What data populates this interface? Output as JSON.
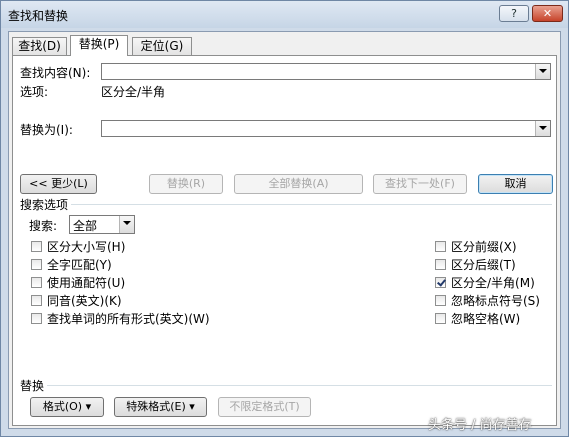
{
  "window": {
    "title": "查找和替换",
    "help_label": "?",
    "close_label": "✕"
  },
  "tabs": [
    {
      "label": "查找(D)",
      "selected": false
    },
    {
      "label": "替换(P)",
      "selected": true
    },
    {
      "label": "定位(G)",
      "selected": false
    }
  ],
  "find": {
    "label": "查找内容(N):",
    "value": ""
  },
  "options_line": {
    "label": "选项:",
    "value": "区分全/半角"
  },
  "replace": {
    "label": "替换为(I):",
    "value": ""
  },
  "buttons": {
    "less": "<< 更少(L)",
    "replace": "替换(R)",
    "replace_all": "全部替换(A)",
    "find_next": "查找下一处(F)",
    "cancel": "取消"
  },
  "search_options": {
    "section_label": "搜索选项",
    "search_label": "搜索:",
    "search_value": "全部",
    "left": [
      {
        "label": "区分大小写(H)",
        "checked": false
      },
      {
        "label": "全字匹配(Y)",
        "checked": false
      },
      {
        "label": "使用通配符(U)",
        "checked": false
      },
      {
        "label": "同音(英文)(K)",
        "checked": false
      },
      {
        "label": "查找单词的所有形式(英文)(W)",
        "checked": false
      }
    ],
    "right": [
      {
        "label": "区分前缀(X)",
        "checked": false
      },
      {
        "label": "区分后缀(T)",
        "checked": false
      },
      {
        "label": "区分全/半角(M)",
        "checked": true
      },
      {
        "label": "忽略标点符号(S)",
        "checked": false
      },
      {
        "label": "忽略空格(W)",
        "checked": false
      }
    ]
  },
  "replace_section": {
    "label": "替换",
    "format_button": "格式(O) ▾",
    "special_button": "特殊格式(E) ▾",
    "no_format_button": "不限定格式(T)"
  },
  "watermark": "头条号 / 尚存善存"
}
